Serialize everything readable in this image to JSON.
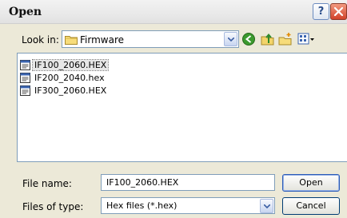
{
  "window": {
    "title": "Open",
    "help_glyph": "?",
    "close_icon": "close-icon"
  },
  "look_in": {
    "label": "Look in:",
    "value": "Firmware",
    "icon": "folder-icon"
  },
  "toolbar": {
    "icons": [
      "back-icon",
      "up-folder-icon",
      "new-folder-icon",
      "view-menu-icon"
    ]
  },
  "files": [
    {
      "name": "IF100_2060.HEX",
      "icon": "hex-file-icon",
      "selected": true
    },
    {
      "name": "IF200_2040.hex",
      "icon": "hex-file-icon",
      "selected": false
    },
    {
      "name": "IF300_2060.HEX",
      "icon": "hex-file-icon",
      "selected": false
    }
  ],
  "file_name": {
    "label": "File name:",
    "value": "IF100_2060.HEX"
  },
  "file_type": {
    "label": "Files of type:",
    "value": "Hex files (*.hex)"
  },
  "buttons": {
    "open": "Open",
    "cancel": "Cancel"
  },
  "colors": {
    "dialog_bg": "#ece9d8",
    "field_border": "#7f9db9",
    "close_red": "#d2422a",
    "back_green": "#3c9a2e"
  }
}
